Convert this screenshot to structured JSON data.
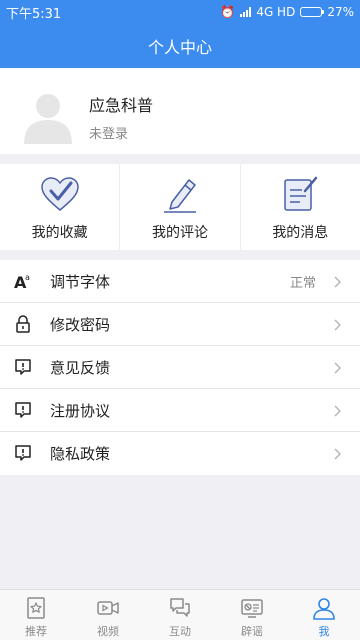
{
  "status_bar": {
    "time": "下午5:31",
    "network": "4G HD",
    "battery": "27%"
  },
  "header": {
    "title": "个人中心"
  },
  "profile": {
    "name": "应急科普",
    "status": "未登录"
  },
  "quick_actions": [
    {
      "label": "我的收藏",
      "icon": "heart-check-icon"
    },
    {
      "label": "我的评论",
      "icon": "pencil-icon"
    },
    {
      "label": "我的消息",
      "icon": "message-edit-icon"
    }
  ],
  "menu": [
    {
      "label": "调节字体",
      "value": "正常",
      "icon": "font-size-icon"
    },
    {
      "label": "修改密码",
      "icon": "lock-icon"
    },
    {
      "label": "意见反馈",
      "icon": "feedback-icon"
    },
    {
      "label": "注册协议",
      "icon": "feedback-icon"
    },
    {
      "label": "隐私政策",
      "icon": "feedback-icon"
    }
  ],
  "tabs": [
    {
      "label": "推荐",
      "icon": "star-doc-icon",
      "active": false
    },
    {
      "label": "视频",
      "icon": "video-icon",
      "active": false
    },
    {
      "label": "互动",
      "icon": "chat-icon",
      "active": false
    },
    {
      "label": "辟谣",
      "icon": "rumor-icon",
      "active": false
    },
    {
      "label": "我",
      "icon": "user-icon",
      "active": true
    }
  ],
  "colors": {
    "primary": "#3c8cf0",
    "tab_active": "#2e86e8",
    "background": "#efeff4"
  }
}
